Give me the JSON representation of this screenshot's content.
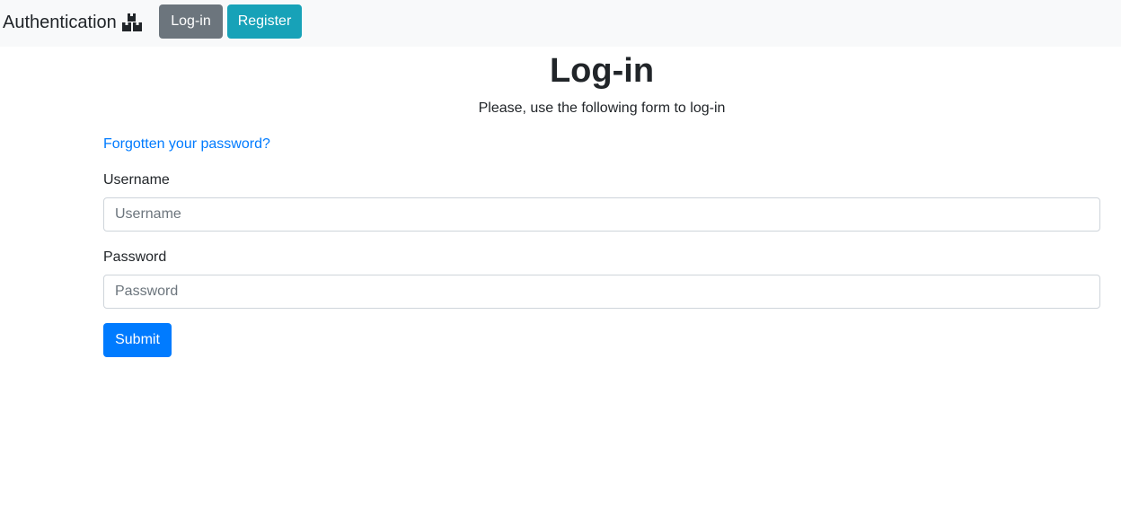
{
  "navbar": {
    "brand": "Authentication",
    "brand_icon": "boxes-icon",
    "login_label": "Log-in",
    "register_label": "Register"
  },
  "page": {
    "title": "Log-in",
    "subtitle": "Please, use the following form to log-in",
    "forgot_link": "Forgotten your password?"
  },
  "form": {
    "username_label": "Username",
    "username_placeholder": "Username",
    "username_value": "",
    "password_label": "Password",
    "password_placeholder": "Password",
    "password_value": "",
    "submit_label": "Submit"
  },
  "colors": {
    "navbar_bg": "#f8f9fa",
    "login_button": "#6c757d",
    "register_button": "#17a2b8",
    "submit_button": "#007bff",
    "link": "#007bff"
  }
}
